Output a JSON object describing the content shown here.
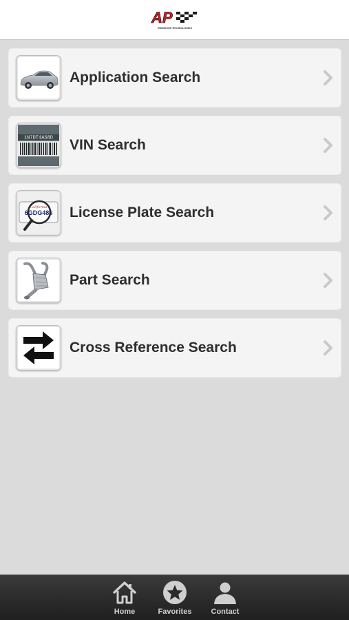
{
  "header": {
    "logo_text": "AP",
    "logo_tagline": "EMISSIONS TECHNOLOGIES",
    "brand_red": "#d81f26"
  },
  "menu": {
    "items": [
      {
        "label": "Application Search",
        "icon": "car-icon"
      },
      {
        "label": "VIN Search",
        "icon": "barcode-icon"
      },
      {
        "label": "License Plate Search",
        "icon": "license-plate-icon"
      },
      {
        "label": "Part Search",
        "icon": "catalytic-converter-icon"
      },
      {
        "label": "Cross Reference Search",
        "icon": "swap-arrows-icon"
      }
    ],
    "vin_sample": "1N7DT4AS8D",
    "plate_sample": "6GDG486"
  },
  "tabbar": {
    "tabs": [
      {
        "label": "Home",
        "icon": "home-icon"
      },
      {
        "label": "Favorites",
        "icon": "star-icon"
      },
      {
        "label": "Contact",
        "icon": "person-icon"
      }
    ]
  }
}
